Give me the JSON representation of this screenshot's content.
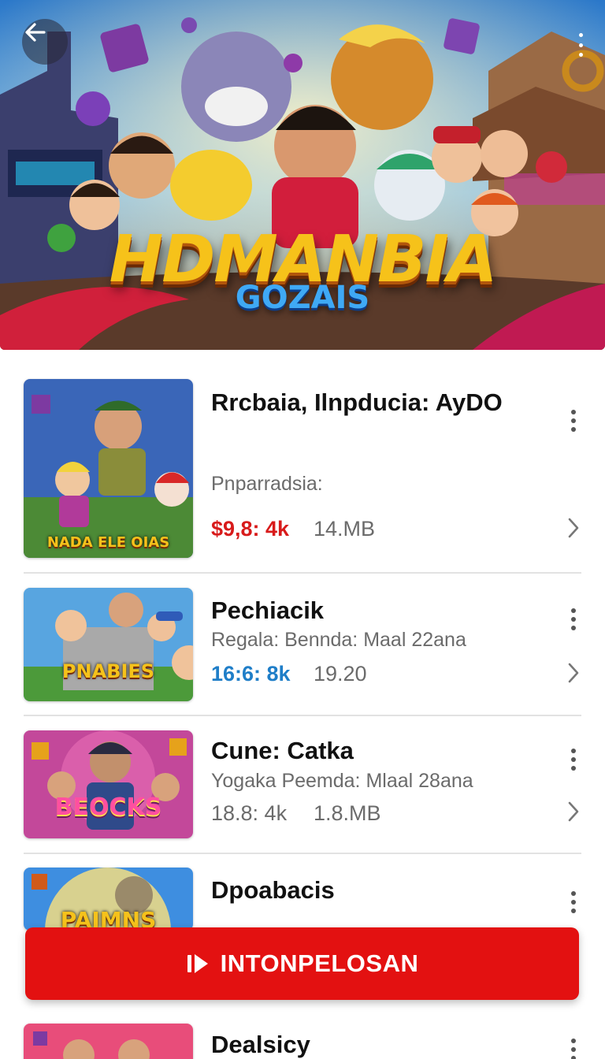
{
  "hero": {
    "title": "HDMANBIA",
    "subtitle": "GOZAIS",
    "back_icon": "arrow-left-icon",
    "more_icon": "more-vertical-icon"
  },
  "items": [
    {
      "title": "Rrcbaia, Ilnpducia: AyDO",
      "subtitle": "Pnparradsiа:",
      "price": "$9,8: 4k",
      "price_color": "#d81b1b",
      "size": "14.MB",
      "thumb_label": "NADA ELE OIAS"
    },
    {
      "title": "Pechiacik",
      "subtitle": "Regala: Bennda: Maal 22ana",
      "price": "16:6: 8k",
      "price_color": "#1f7ec8",
      "size": "19.20",
      "thumb_label": "PNABIES"
    },
    {
      "title": "Cune: Catka",
      "subtitle": "Yogaka Peemda: Mlaal 28ana",
      "price": "18.8: 4k",
      "price_color": "#6b6b6b",
      "size": "1.8.MB",
      "thumb_label": "BEOCKS"
    },
    {
      "title": "Dpoabacis",
      "thumb_label": "PAIMNS"
    },
    {
      "title": "Dealsicy"
    }
  ],
  "cta": {
    "label": "INTONPELOSAN",
    "icon": "play-icon",
    "color": "#e31111"
  }
}
